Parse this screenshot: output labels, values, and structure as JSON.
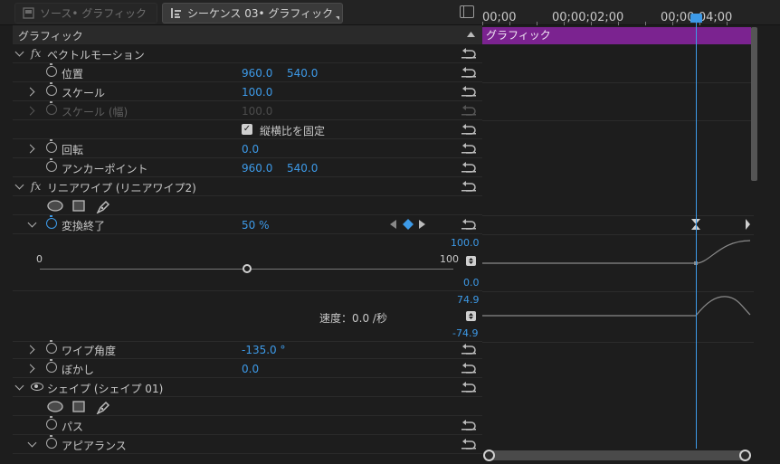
{
  "tabs": {
    "source_label": "ソース• グラフィック",
    "sequence_label": "シーケンス 03• グラフィック"
  },
  "ruler": {
    "t0": "00;00",
    "t1": "00;00;02;00",
    "t2": "00;00;04;00"
  },
  "clip": {
    "label": "グラフィック"
  },
  "panel": {
    "title": "グラフィック"
  },
  "motion": {
    "title": "ベクトルモーション",
    "position": {
      "label": "位置",
      "x": "960.0",
      "y": "540.0"
    },
    "scale": {
      "label": "スケール",
      "value": "100.0"
    },
    "scale_width": {
      "label": "スケール (幅)",
      "value": "100.0"
    },
    "uniform": {
      "label": "縦横比を固定",
      "checked": true
    },
    "rotation": {
      "label": "回転",
      "value": "0.0"
    },
    "anchor": {
      "label": "アンカーポイント",
      "x": "960.0",
      "y": "540.0"
    }
  },
  "wipe": {
    "title": "リニアワイプ (リニアワイプ2)",
    "transition": {
      "label": "変換終了",
      "value": "50 %"
    },
    "graph": {
      "value_max": "100.0",
      "value_min": "0.0",
      "slider_min": "0",
      "slider_max": "100",
      "slider_value": 50,
      "velocity_max": "74.9",
      "velocity_min": "-74.9",
      "velocity_label": "速度：0.0 /秒"
    },
    "angle": {
      "label": "ワイプ角度",
      "value": "-135.0 °"
    },
    "feather": {
      "label": "ぼかし",
      "value": "0.0"
    }
  },
  "shape": {
    "title": "シェイプ (シェイプ 01)",
    "path": {
      "label": "パス"
    },
    "appearance": {
      "label": "アピアランス"
    }
  },
  "colors": {
    "accent": "#3d9ae8",
    "clip": "#7b2390"
  }
}
